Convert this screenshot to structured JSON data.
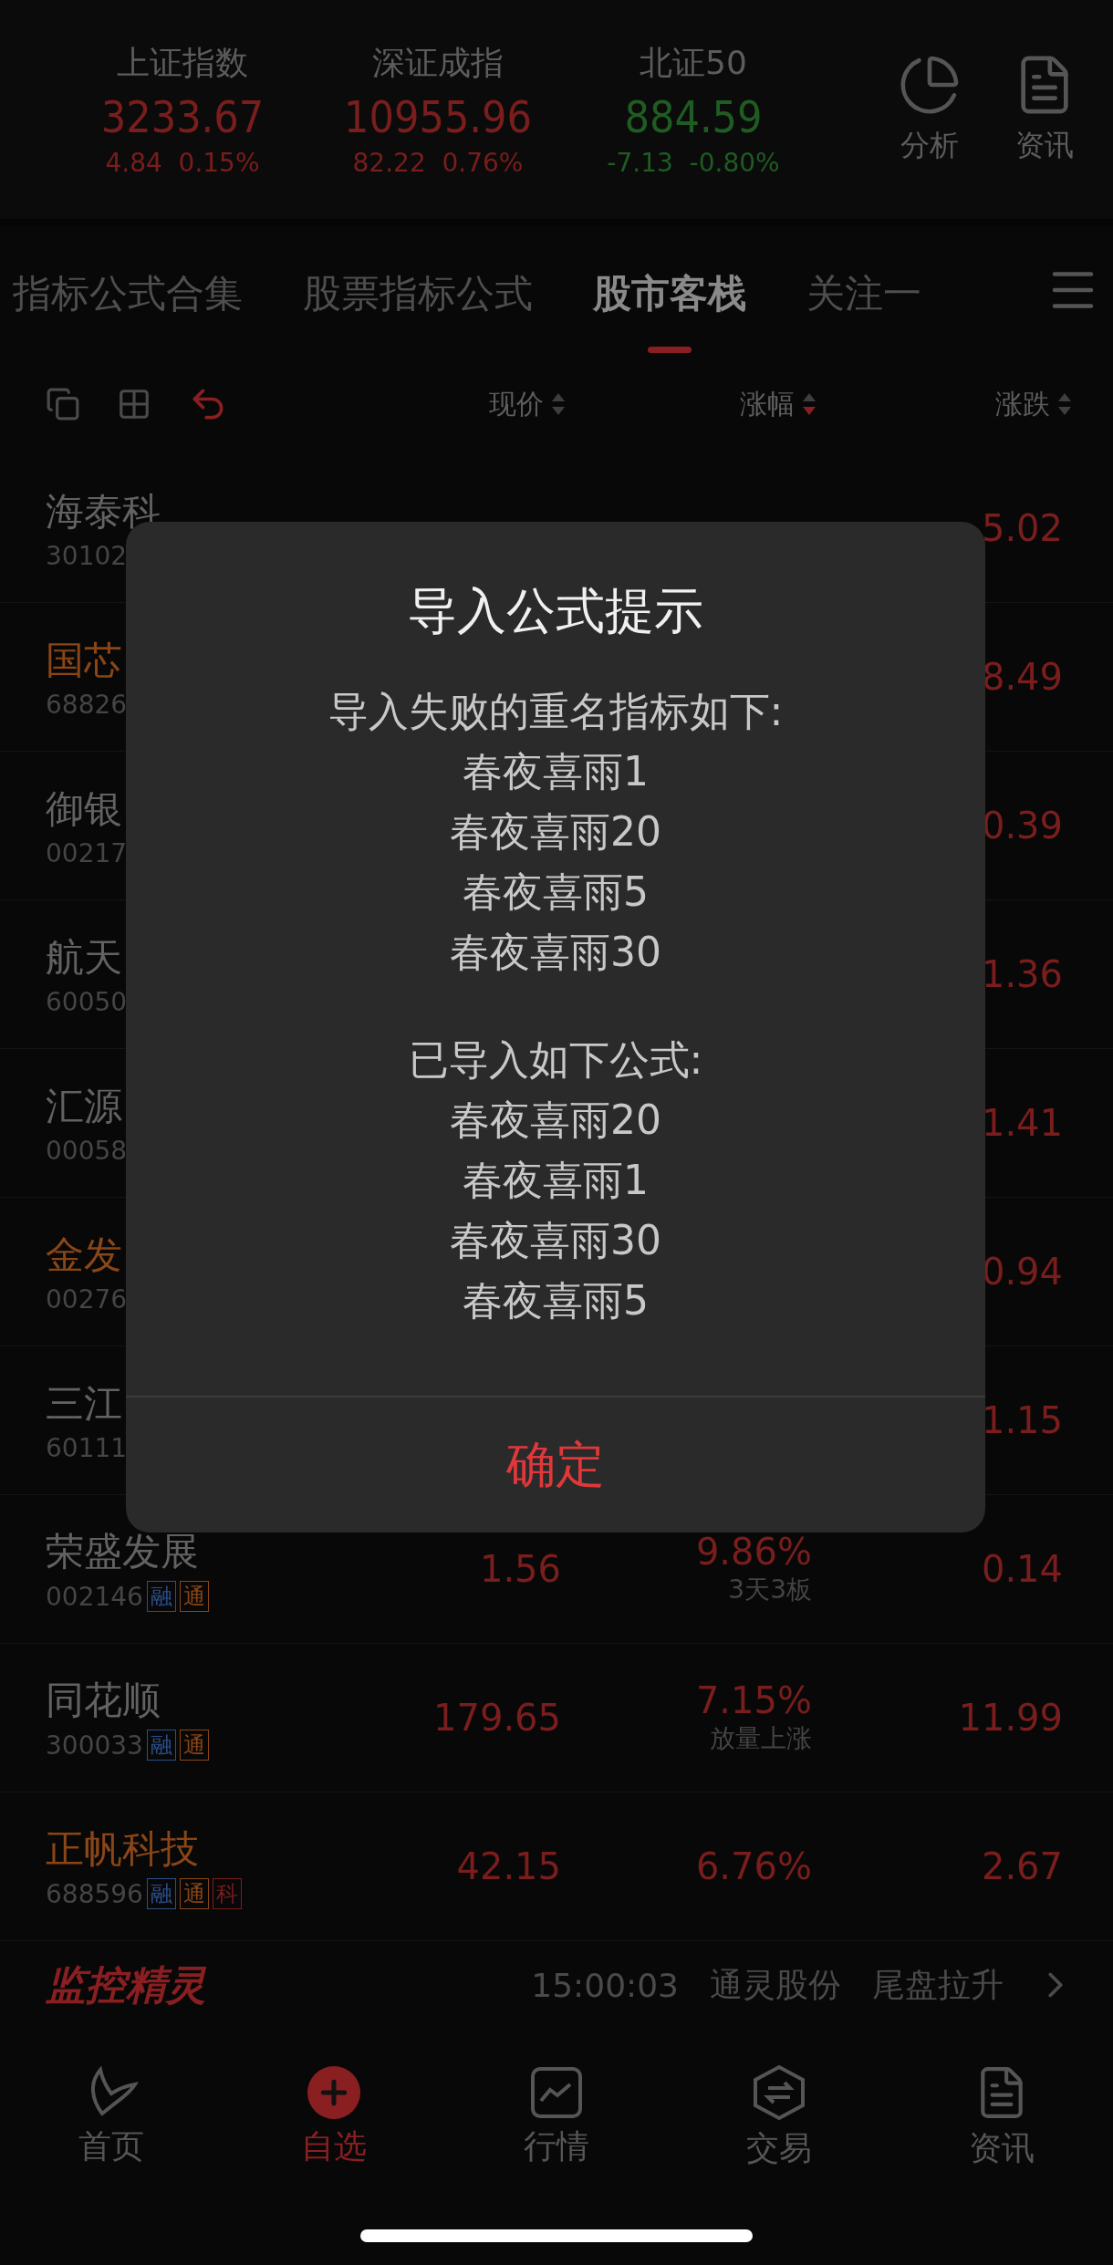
{
  "indices": [
    {
      "name": "上证指数",
      "value": "3233.67",
      "change": "4.84",
      "percent": "0.15%",
      "falling": false
    },
    {
      "name": "深证成指",
      "value": "10955.96",
      "change": "82.22",
      "percent": "0.76%",
      "falling": false
    },
    {
      "name": "北证50",
      "value": "884.59",
      "change": "-7.13",
      "percent": "-0.80%",
      "falling": true
    }
  ],
  "header_actions": [
    {
      "label": "分析",
      "kind": "analysis"
    },
    {
      "label": "资讯",
      "kind": "news"
    }
  ],
  "tabs": [
    {
      "label": "指标公式合集",
      "selected": false
    },
    {
      "label": "股票指标公式",
      "selected": false
    },
    {
      "label": "股市客栈",
      "selected": true
    },
    {
      "label": "关注一",
      "selected": false
    }
  ],
  "columns": [
    {
      "label": "现价",
      "sorted_descending": false
    },
    {
      "label": "涨幅",
      "sorted_descending": true
    },
    {
      "label": "涨跌",
      "sorted_descending": false
    }
  ],
  "rows": [
    {
      "name": "海泰科",
      "code": "30102",
      "highlighted": false,
      "change": "5.02"
    },
    {
      "name": "国芯",
      "code": "68826",
      "highlighted": true,
      "change": "8.49"
    },
    {
      "name": "御银",
      "code": "00217",
      "highlighted": false,
      "change": "0.39"
    },
    {
      "name": "航天",
      "code": "60050",
      "highlighted": false,
      "change": "1.36"
    },
    {
      "name": "汇源",
      "code": "00058",
      "highlighted": false,
      "change": "1.41"
    },
    {
      "name": "金发",
      "code": "00276",
      "highlighted": true,
      "change": "0.94"
    },
    {
      "name": "三江",
      "code": "60111",
      "highlighted": false,
      "change": "1.15"
    },
    {
      "name": "荣盛发展",
      "code": "002146",
      "highlighted": false,
      "tags": [
        {
          "label": "融",
          "kind": "margin"
        },
        {
          "label": "通",
          "kind": "connect"
        }
      ],
      "price": "1.56",
      "percent": "9.86%",
      "note": "3天3板",
      "change": "0.14"
    },
    {
      "name": "同花顺",
      "code": "300033",
      "highlighted": false,
      "tags": [
        {
          "label": "融",
          "kind": "margin"
        },
        {
          "label": "通",
          "kind": "connect"
        }
      ],
      "price": "179.65",
      "percent": "7.15%",
      "note": "放量上涨",
      "change": "11.99"
    },
    {
      "name": "正帆科技",
      "code": "688596",
      "highlighted": true,
      "tags": [
        {
          "label": "融",
          "kind": "margin"
        },
        {
          "label": "通",
          "kind": "connect"
        },
        {
          "label": "科",
          "kind": "star"
        }
      ],
      "price": "42.15",
      "percent": "6.76%",
      "change": "2.67"
    }
  ],
  "monitor": {
    "logo": "监控精灵",
    "time": "15:00:03",
    "stock": "通灵股份",
    "signal": "尾盘拉升"
  },
  "nav": [
    {
      "label": "首页",
      "kind": "home",
      "selected": false
    },
    {
      "label": "自选",
      "kind": "watchlist",
      "selected": true
    },
    {
      "label": "行情",
      "kind": "market",
      "selected": false
    },
    {
      "label": "交易",
      "kind": "trade",
      "selected": false
    },
    {
      "label": "资讯",
      "kind": "news",
      "selected": false
    }
  ],
  "dialog": {
    "title": "导入公式提示",
    "sections": [
      {
        "heading": "导入失败的重名指标如下:",
        "items": [
          "春夜喜雨1",
          "春夜喜雨20",
          "春夜喜雨5",
          "春夜喜雨30"
        ]
      },
      {
        "heading": "已导入如下公式:",
        "items": [
          "春夜喜雨20",
          "春夜喜雨1",
          "春夜喜雨30",
          "春夜喜雨5"
        ]
      }
    ],
    "button": "确定"
  }
}
